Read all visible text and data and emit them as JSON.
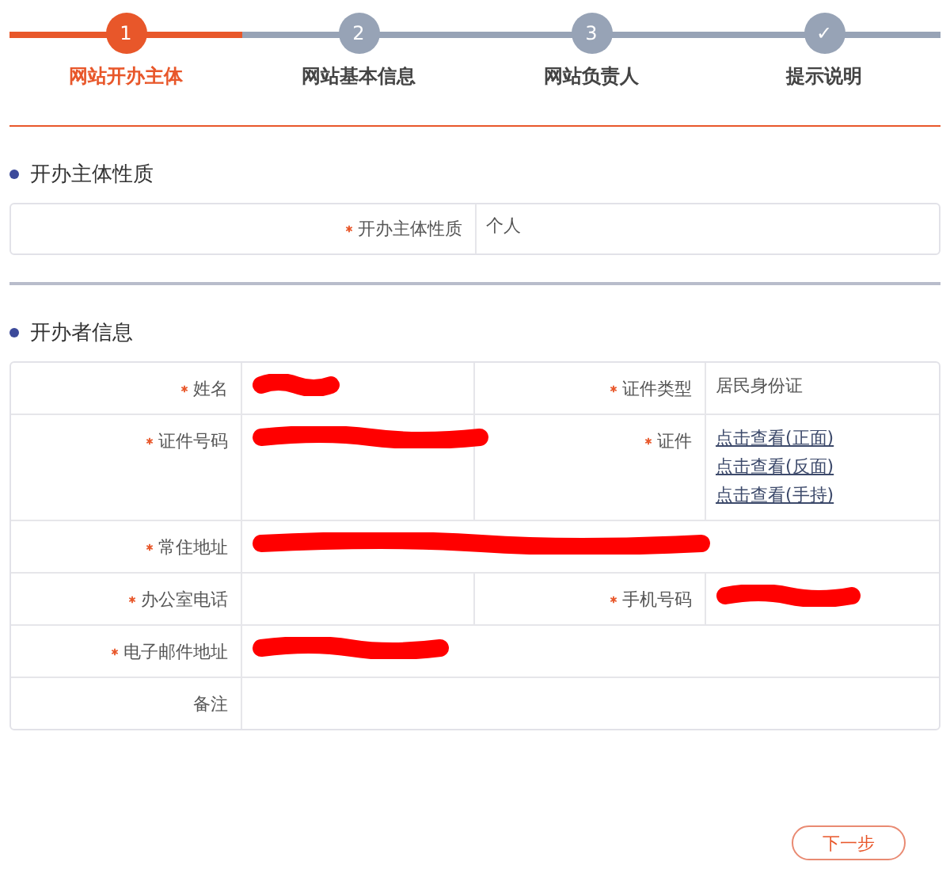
{
  "steps": [
    {
      "marker": "1",
      "label": "网站开办主体",
      "selected": true
    },
    {
      "marker": "2",
      "label": "网站基本信息",
      "selected": false
    },
    {
      "marker": "3",
      "label": "网站负责人",
      "selected": false
    },
    {
      "marker": "✓",
      "label": "提示说明",
      "selected": false
    }
  ],
  "subject_section": {
    "title": "开办主体性质",
    "field": {
      "label": "开办主体性质",
      "required": true,
      "value": "个人"
    }
  },
  "owner_section": {
    "title": "开办者信息",
    "rows": [
      {
        "cells": [
          {
            "label": "姓名",
            "required": true,
            "kind": "redacted"
          },
          {
            "label": "证件类型",
            "required": true,
            "kind": "text",
            "value": "居民身份证"
          }
        ]
      },
      {
        "cells": [
          {
            "label": "证件号码",
            "required": true,
            "kind": "redacted"
          },
          {
            "label": "证件",
            "required": true,
            "kind": "links",
            "links": [
              "点击查看(正面)",
              "点击查看(反面)",
              "点击查看(手持)"
            ]
          }
        ]
      },
      {
        "cells": [
          {
            "label": "常住地址",
            "required": true,
            "kind": "redacted"
          }
        ]
      },
      {
        "cells": [
          {
            "label": "办公室电话",
            "required": true,
            "kind": "empty"
          },
          {
            "label": "手机号码",
            "required": true,
            "kind": "redacted"
          }
        ]
      },
      {
        "cells": [
          {
            "label": "电子邮件地址",
            "required": true,
            "kind": "redacted"
          }
        ]
      },
      {
        "cells": [
          {
            "label": "备注",
            "required": false,
            "kind": "empty"
          }
        ]
      }
    ]
  },
  "next_button": "下一步"
}
